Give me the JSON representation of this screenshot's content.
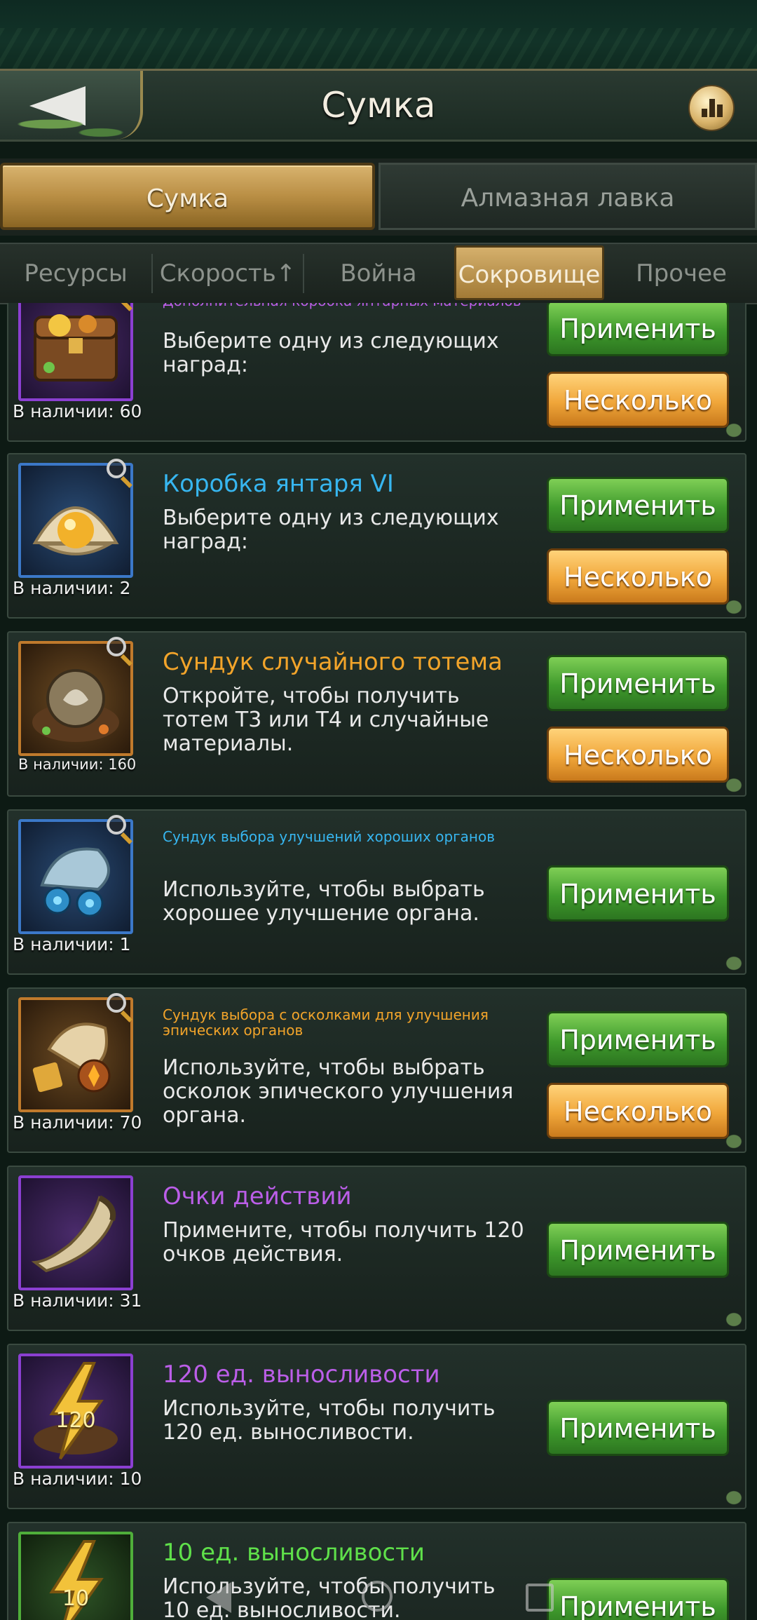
{
  "header": {
    "title": "Сумка"
  },
  "main_tabs": [
    {
      "label": "Сумка",
      "active": true
    },
    {
      "label": "Алмазная лавка",
      "active": false
    }
  ],
  "sub_tabs": [
    {
      "label": "Ресурсы",
      "active": false
    },
    {
      "label": "Скорость↑",
      "active": false
    },
    {
      "label": "Война",
      "active": false
    },
    {
      "label": "Сокровище",
      "active": true
    },
    {
      "label": "Прочее",
      "active": false
    }
  ],
  "items": [
    {
      "title": "Дополнительная коробка янтарных материалов",
      "desc": "Выберите одну из следующих наград:",
      "available": "В наличии: 60",
      "apply_label": "Применить",
      "multi_label": "Несколько"
    },
    {
      "title": "Коробка янтаря VI",
      "desc": "Выберите одну из следующих наград:",
      "available": "В наличии: 2",
      "apply_label": "Применить",
      "multi_label": "Несколько"
    },
    {
      "title": "Сундук случайного тотема",
      "desc": "Откройте, чтобы получить тотем Т3 или Т4 и случайные материалы.",
      "available": "В наличии: 160",
      "apply_label": "Применить",
      "multi_label": "Несколько"
    },
    {
      "title": "Сундук выбора улучшений хороших органов",
      "desc": "Используйте, чтобы выбрать хорошее улучшение органа.",
      "available": "В наличии: 1",
      "apply_label": "Применить"
    },
    {
      "title": "Сундук выбора с осколками для улучшения эпических органов",
      "desc": "Используйте, чтобы выбрать осколок эпического улучшения органа.",
      "available": "В наличии: 70",
      "apply_label": "Применить",
      "multi_label": "Несколько"
    },
    {
      "title": "Очки действий",
      "desc": "Примените, чтобы получить 120 очков действия.",
      "available": "В наличии: 31",
      "apply_label": "Применить"
    },
    {
      "title": "120 ед. выносливости",
      "desc": "Используйте, чтобы получить 120 ед. выносливости.",
      "available": "В наличии: 10",
      "apply_label": "Применить",
      "icon_number": "120"
    },
    {
      "title": "10 ед. выносливости",
      "desc": "Используйте, чтобы получить 10 ед. выносливости.",
      "apply_label": "Применить",
      "icon_number": "10"
    }
  ],
  "colors": {
    "title_purple": "#bb5ee8",
    "title_blue": "#37b6f0",
    "title_orange": "#f2a42a",
    "title_green": "#5fe04a",
    "button_green": "#3f9a2c",
    "button_orange": "#f0a63a",
    "tab_gold": "#b98e44"
  },
  "icons": {
    "back": "arrow-left-icon",
    "rank": "bar-chart-icon",
    "inspect": "magnifier-icon"
  }
}
